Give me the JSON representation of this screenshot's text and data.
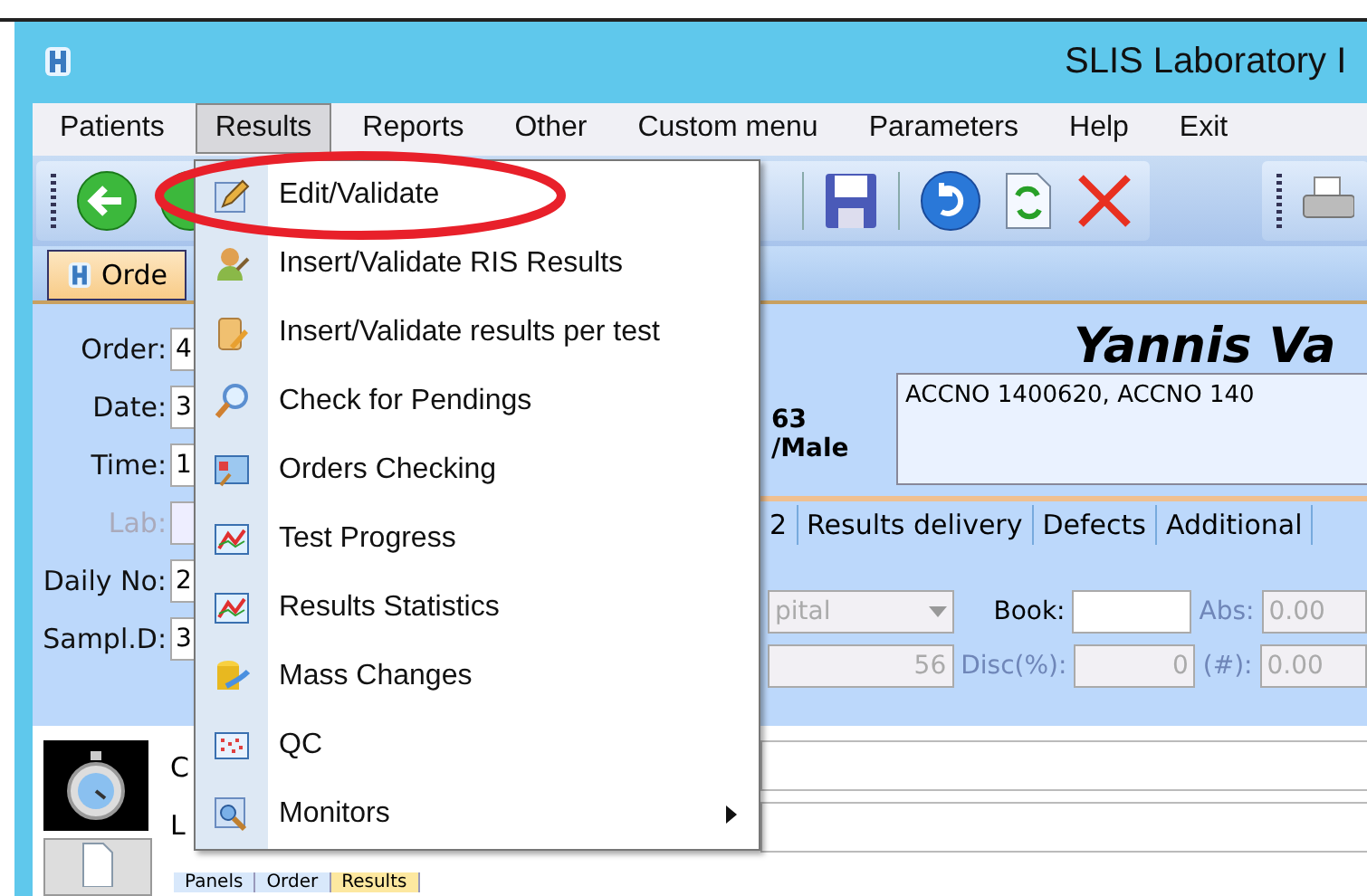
{
  "window": {
    "title": "SLIS Laboratory I"
  },
  "menu_bar": [
    {
      "label": "Patients",
      "selected": false
    },
    {
      "label": "Results",
      "selected": true
    },
    {
      "label": "Reports",
      "selected": false
    },
    {
      "label": "Other",
      "selected": false
    },
    {
      "label": "Custom menu",
      "selected": false
    },
    {
      "label": "Parameters",
      "selected": false
    },
    {
      "label": "Help",
      "selected": false
    },
    {
      "label": "Exit",
      "selected": false
    }
  ],
  "results_menu": [
    {
      "label": "Edit/Validate",
      "highlighted": true,
      "kind": "item"
    },
    {
      "label": "Insert/Validate RIS Results",
      "highlighted": false,
      "kind": "item"
    },
    {
      "label": "Insert/Validate results per test",
      "highlighted": false,
      "kind": "item"
    },
    {
      "label": "Check for Pendings",
      "highlighted": false,
      "kind": "item"
    },
    {
      "label": "Orders Checking",
      "highlighted": false,
      "kind": "item"
    },
    {
      "label": "Test Progress",
      "highlighted": false,
      "kind": "item"
    },
    {
      "label": "Results Statistics",
      "highlighted": false,
      "kind": "item"
    },
    {
      "label": "Mass Changes",
      "highlighted": false,
      "kind": "item"
    },
    {
      "label": "QC",
      "highlighted": false,
      "kind": "item"
    },
    {
      "label": "Monitors",
      "highlighted": false,
      "kind": "submenu"
    }
  ],
  "document_tab": {
    "label": "Orde"
  },
  "order_form": [
    {
      "label": "Order:",
      "value": "4",
      "disabled": false
    },
    {
      "label": "Date:",
      "value": "3",
      "disabled": false
    },
    {
      "label": "Time:",
      "value": "1",
      "disabled": false
    },
    {
      "label": "Lab:",
      "disabled": true
    },
    {
      "label": "Daily No:",
      "value": "2",
      "disabled": false
    },
    {
      "label": "Sampl.D:",
      "value": "3",
      "disabled": false
    }
  ],
  "patient": {
    "name": "Yannis Va",
    "details": [
      "63",
      "/Male"
    ],
    "accession": "ACCNO 1400620, ACCNO 140"
  },
  "detail_tabs": [
    {
      "label": "2"
    },
    {
      "label": "Results delivery"
    },
    {
      "label": "Defects"
    },
    {
      "label": "Additional"
    }
  ],
  "billing": {
    "hospital": "pital",
    "book_label": "Book:",
    "abs_label": "Abs:",
    "abs_value": "0.00",
    "amount": "56",
    "disc_label": "Disc(%):",
    "disc_value": "0",
    "count_label": "(#):",
    "count_value": "0.00"
  },
  "bottom_panel": {
    "labels": [
      "C",
      "L"
    ]
  },
  "bottom_tabs": [
    {
      "label": "Panels",
      "selected": false
    },
    {
      "label": "Order",
      "selected": false
    },
    {
      "label": "Results",
      "selected": true
    }
  ]
}
